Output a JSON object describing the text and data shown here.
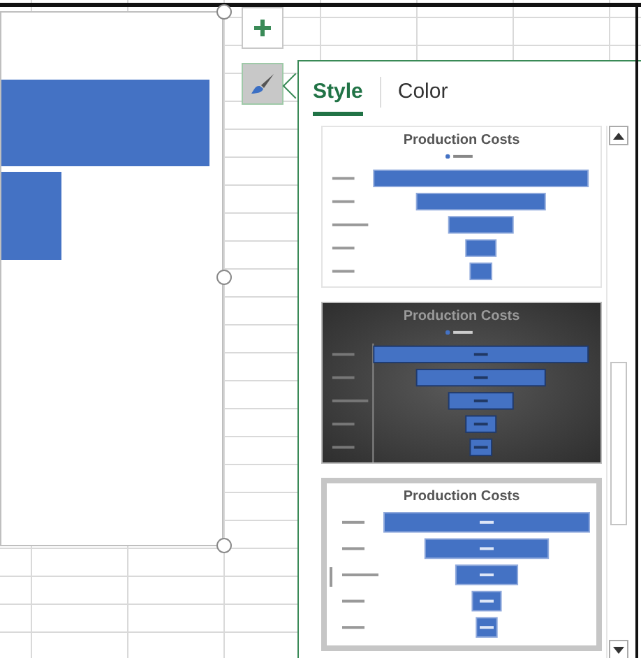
{
  "chart_buttons": {
    "styles_active": true
  },
  "style_panel": {
    "tabs": [
      {
        "label": "Style",
        "selected": true
      },
      {
        "label": "Color",
        "selected": false
      }
    ],
    "styles": [
      {
        "kind": "plain",
        "title": "Production Costs",
        "selected": false
      },
      {
        "kind": "dark",
        "title": "Production Costs",
        "selected": false
      },
      {
        "kind": "labeled",
        "title": "Production Costs",
        "selected": true
      }
    ]
  }
}
